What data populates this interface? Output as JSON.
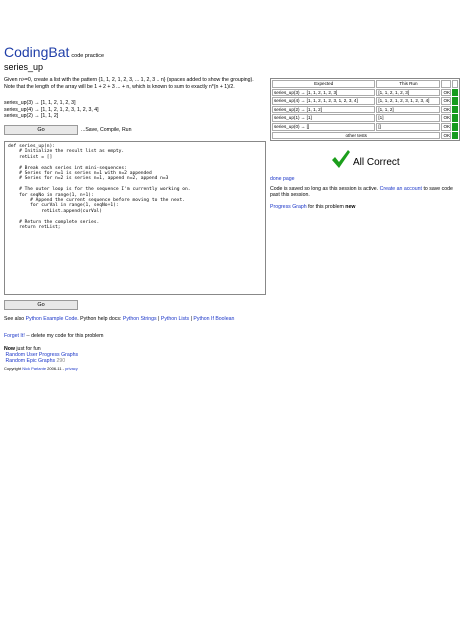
{
  "header": {
    "brand": "CodingBat",
    "subtitle": "code practice"
  },
  "problem": {
    "title": "series_up",
    "description": "Given n>=0, create a list with the pattern {1, 1, 2, 1, 2, 3, ... 1, 2, 3 .. n} (spaces added to show the grouping). Note that the length of the array will be 1 + 2 + 3 ... + n, which is known to sum to exactly n*(n + 1)/2.",
    "examples": "series_up(3) → [1, 1, 2, 1, 2, 3]\nseries_up(4) → [1, 1, 2, 1, 2, 3, 1, 2, 3, 4]\nseries_up(2) → [1, 1, 2]"
  },
  "controls": {
    "go_label": "Go",
    "go_note": "...Save, Compile, Run"
  },
  "editor": {
    "code": "def series_up(n):\n    # Initialize the result list as empty.\n    retList = []\n\n    # Break each series int mini-sequences:\n    # Series for n=1 is series n=1 with n=2 appended\n    # Series for n=2 is series n=1, append n=2, append n=3\n\n    # The outer loop is for the sequence I'm currently working on.\n    for seqNo in range(1, n+1):\n        # Append the current sequence before moving to the next.\n        for curVal in range(1, seqNo+1):\n            retList.append(curVal)\n\n    # Return the complete series.\n    return retList;"
  },
  "help": {
    "prefix": "See also",
    "python_example_code": "Python Example Code",
    "middle": ". Python help docs:",
    "python_strings": "Python Strings",
    "sep": "|",
    "python_lists": "Python Lists",
    "python_if_boolean": "Python If Boolean"
  },
  "forget": {
    "link": "Forget It!",
    "text": "-- delete my code for this problem"
  },
  "fun": {
    "now": "Now",
    "just_for_fun": "just for fun",
    "random_user_progress": "Random User Progress Graphs",
    "random_epic_graphs": "Random Epic Graphs",
    "epic_count": "290"
  },
  "footer": {
    "copyright": "Copyright",
    "author": "Nick Parlante",
    "years": "2006-11 -",
    "privacy": "privacy"
  },
  "results": {
    "headers": {
      "expected": "Expected",
      "run": "This Run"
    },
    "rows": [
      {
        "expected": "series_up(3) → [1, 1, 2, 1, 2, 3]",
        "run": "[1, 1, 2, 1, 2, 3]",
        "status": "OK"
      },
      {
        "expected": "series_up(4) → [1, 1, 2, 1, 2, 3, 1, 2, 3, 4]",
        "run": "[1, 1, 2, 1, 2, 3, 1, 2, 3, 4]",
        "status": "OK"
      },
      {
        "expected": "series_up(2) → [1, 1, 2]",
        "run": "[1, 1, 2]",
        "status": "OK"
      },
      {
        "expected": "series_up(1) → [1]",
        "run": "[1]",
        "status": "OK"
      },
      {
        "expected": "series_up(0) → []",
        "run": "[]",
        "status": "OK"
      }
    ],
    "other_tests": "other tests",
    "other_status": "OK",
    "pass_color": "#179b1f"
  },
  "verdict": {
    "all_correct": "All Correct",
    "done_page": "done page",
    "saved_prefix": "Code is saved so long as this session is active.",
    "create_account": "Create an account",
    "saved_suffix": "to save code past this session.",
    "progress_graph": "Progress Graph",
    "graph_suffix": "for this problem",
    "new": "new"
  }
}
